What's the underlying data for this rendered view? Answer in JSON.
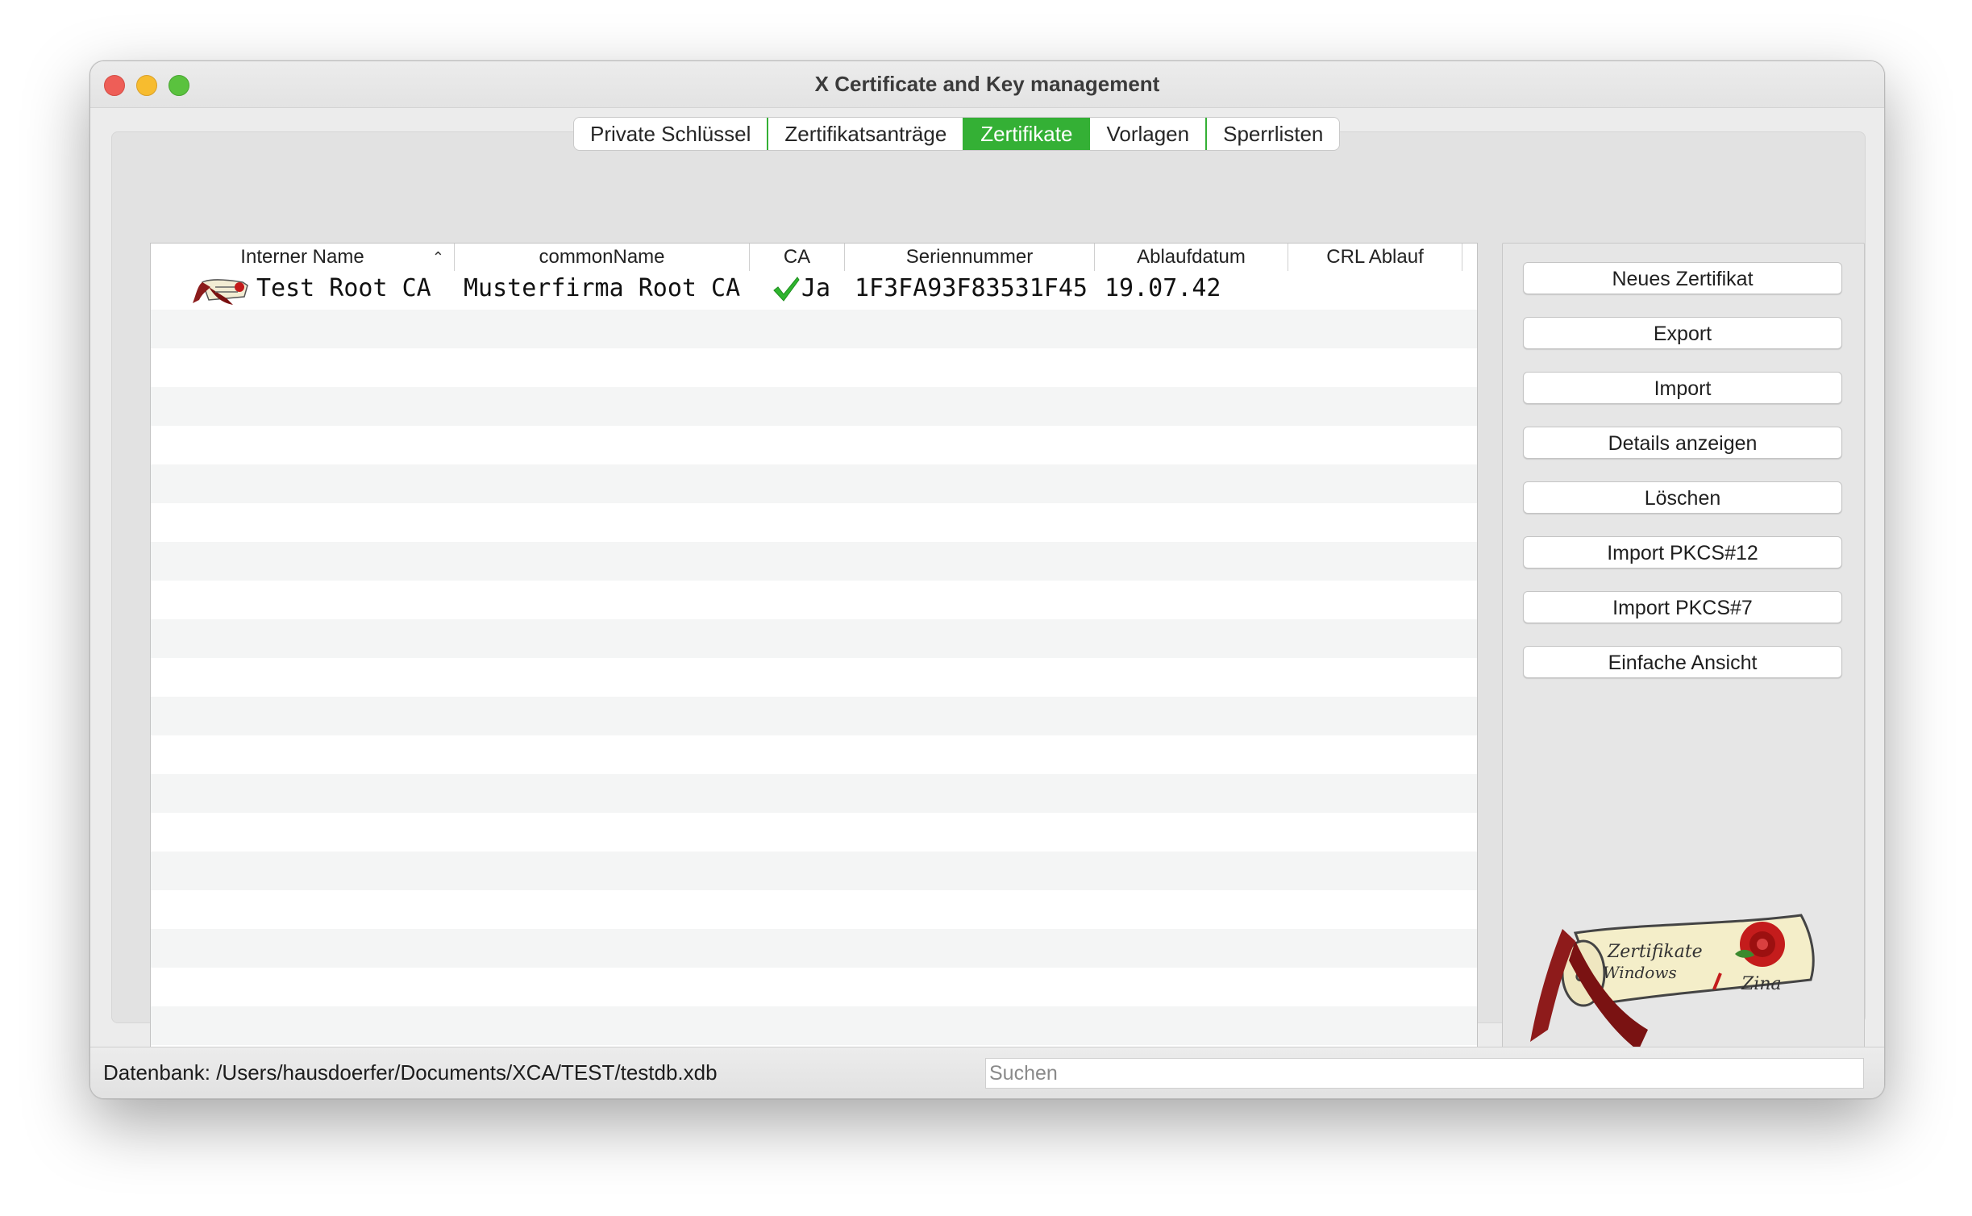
{
  "window": {
    "title": "X Certificate and Key management"
  },
  "tabs": [
    {
      "label": "Private Schlüssel",
      "active": false
    },
    {
      "label": "Zertifikatsanträge",
      "active": false
    },
    {
      "label": "Zertifikate",
      "active": true
    },
    {
      "label": "Vorlagen",
      "active": false
    },
    {
      "label": "Sperrlisten",
      "active": false
    }
  ],
  "table": {
    "columns": [
      "Interner Name",
      "commonName",
      "CA",
      "Seriennummer",
      "Ablaufdatum",
      "CRL Ablauf"
    ],
    "sort_indicator": "⌃",
    "rows": [
      {
        "icon": "certificate-icon",
        "internal_name": "Test Root CA",
        "common_name": "Musterfirma Root CA",
        "ca_icon": "checkmark-icon",
        "ca": "Ja",
        "serial": "1F3FA93F83531F45",
        "expiry": "19.07.42",
        "crl_expiry": ""
      }
    ]
  },
  "actions": {
    "new_certificate": "Neues Zertifikat",
    "export": "Export",
    "import": "Import",
    "show_details": "Details anzeigen",
    "delete": "Löschen",
    "import_pkcs12": "Import PKCS#12",
    "import_pkcs7": "Import PKCS#7",
    "simple_view": "Einfache Ansicht"
  },
  "logo": {
    "icon": "scroll-logo-icon",
    "text_line1": "Zertifikate",
    "text_line2": "Windows",
    "text_line3": "Zina"
  },
  "status": {
    "database": "Datenbank: /Users/hausdoerfer/Documents/XCA/TEST/testdb.xdb",
    "search_placeholder": "Suchen"
  },
  "colors": {
    "accent": "#34b035",
    "stripe": "#f4f5f5"
  }
}
